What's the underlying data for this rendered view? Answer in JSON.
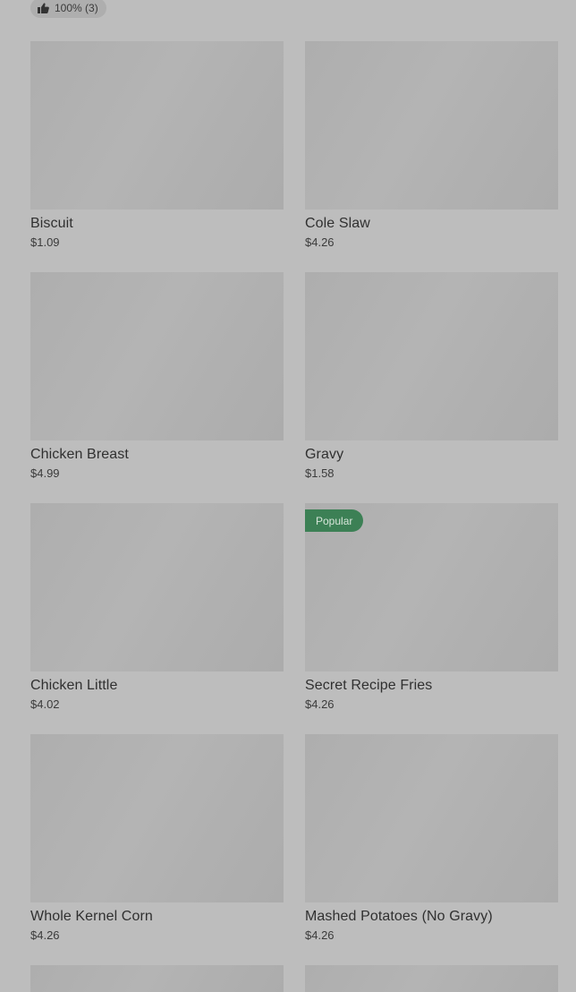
{
  "rating": {
    "icon": "thumbs-up-icon",
    "text": "100% (3)"
  },
  "badge_color": "#3c8055",
  "items": [
    {
      "name": "Biscuit",
      "price": "$1.09",
      "badge": ""
    },
    {
      "name": "Cole Slaw",
      "price": "$4.26",
      "badge": ""
    },
    {
      "name": "Chicken Breast",
      "price": "$4.99",
      "badge": ""
    },
    {
      "name": "Gravy",
      "price": "$1.58",
      "badge": ""
    },
    {
      "name": "Chicken Little",
      "price": "$4.02",
      "badge": ""
    },
    {
      "name": "Secret Recipe Fries",
      "price": "$4.26",
      "badge": "Popular"
    },
    {
      "name": "Whole Kernel Corn",
      "price": "$4.26",
      "badge": ""
    },
    {
      "name": "Mashed Potatoes (No Gravy)",
      "price": "$4.26",
      "badge": ""
    }
  ]
}
